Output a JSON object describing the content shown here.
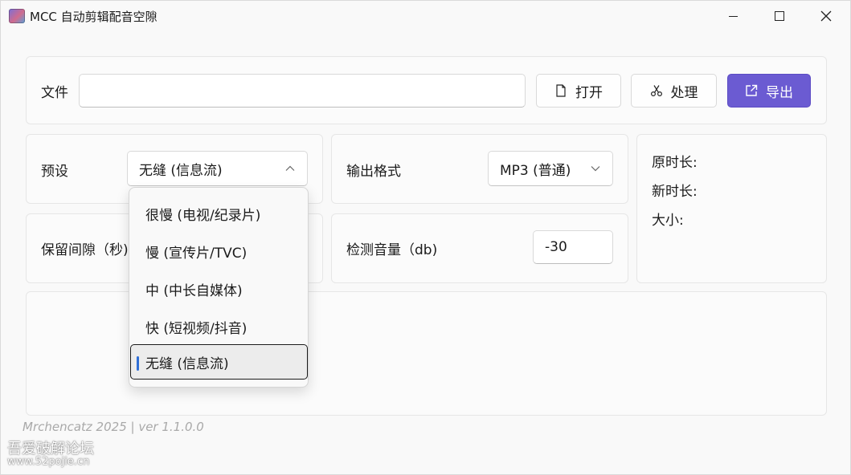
{
  "window": {
    "title": "MCC 自动剪辑配音空隙"
  },
  "file_row": {
    "label": "文件",
    "input_value": "",
    "open_label": "打开",
    "process_label": "处理",
    "export_label": "导出",
    "export_color": "#6b5bd2"
  },
  "preset": {
    "label": "预设",
    "selected": "无缝 (信息流)",
    "options": [
      "很慢 (电视/纪录片)",
      "慢 (宣传片/TVC)",
      "中 (中长自媒体)",
      "快 (短视频/抖音)",
      "无缝 (信息流)"
    ],
    "selected_index": 4,
    "accent": "#2f6fd6"
  },
  "output_format": {
    "label": "输出格式",
    "selected": "MP3 (普通)"
  },
  "info": {
    "original_duration_label": "原时长:",
    "new_duration_label": "新时长:",
    "size_label": "大小:"
  },
  "gap": {
    "label": "保留间隙（秒)"
  },
  "volume": {
    "label": "检测音量（db)",
    "value": "-30"
  },
  "footer": {
    "text": "Mrchencatz 2025 | ver 1.1.0.0"
  },
  "watermark": {
    "name": "吾爱破解论坛",
    "url": "www.52pojie.cn"
  }
}
